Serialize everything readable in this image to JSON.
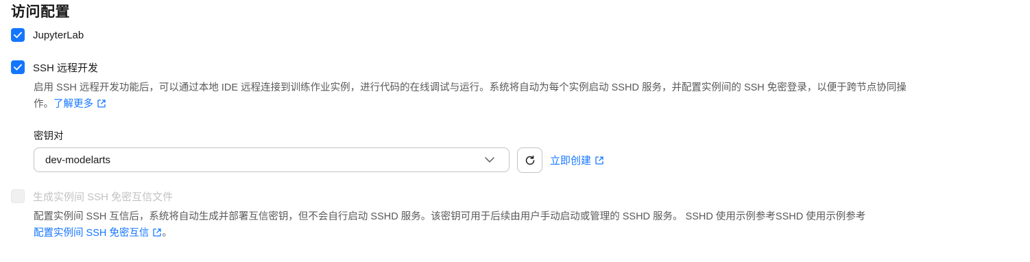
{
  "section": {
    "title": "访问配置"
  },
  "jupyterlab": {
    "label": "JupyterLab",
    "checked": true
  },
  "ssh": {
    "label": "SSH 远程开发",
    "checked": true,
    "description_line1": "启用 SSH 远程开发功能后，可以通过本地 IDE 远程连接到训练作业实例，进行代码的在线调试与运行。系统将自动为每个实例启动 SSHD 服务，并配置实例间的 SSH 免密登录，以便于跨节点协同操",
    "description_line2_prefix": "作。",
    "learn_more_label": "了解更多",
    "key_pair": {
      "label": "密钥对",
      "selected_value": "dev-modelarts",
      "create_now_label": "立即创建"
    }
  },
  "mutual_trust": {
    "label": "生成实例间 SSH 免密互信文件",
    "checked": false,
    "disabled": true,
    "description_line1": "配置实例间 SSH 互信后，系统将自动生成并部署互信密钥，但不会自行启动 SSHD 服务。该密钥可用于后续由用户手动启动或管理的 SSHD 服务。 SSHD 使用示例参考SSHD 使用示例参考",
    "link_label": "配置实例间 SSH 免密互信",
    "description_suffix": "。"
  },
  "colors": {
    "primary": "#1476ff",
    "text": "#191919",
    "secondary_text": "#595959",
    "disabled_text": "#c2c2c2",
    "border": "#c2c2c2"
  },
  "icons": {
    "checkbox_check": "check-icon",
    "external_link": "external-link-icon",
    "dropdown": "chevron-down-icon",
    "refresh": "refresh-icon"
  }
}
